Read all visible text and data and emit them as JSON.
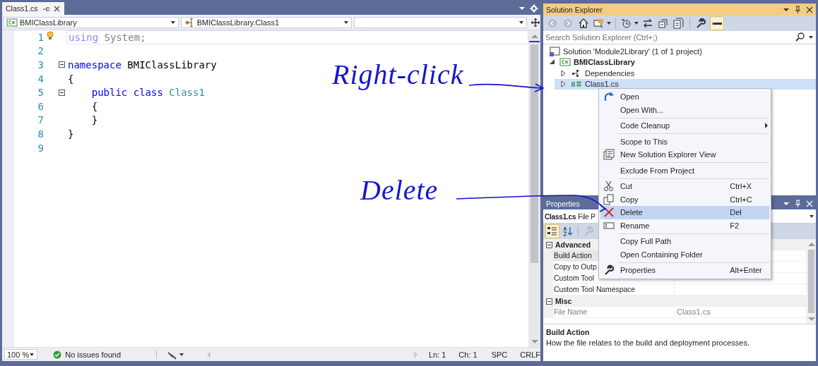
{
  "editor_tab": {
    "title": "Class1.cs",
    "selected": true
  },
  "nav_bar": {
    "project": "BMIClassLibrary",
    "type": "BMIClassLibrary.Class1"
  },
  "code": {
    "lines": [
      {
        "number": "1",
        "hint": true,
        "current": true,
        "fold": false,
        "tokens": [
          {
            "text": "using",
            "kind": "unused-keyword"
          },
          {
            "text": " System;",
            "kind": "unused"
          }
        ]
      },
      {
        "number": "2",
        "hint": false,
        "current": false,
        "fold": false
      },
      {
        "number": "3",
        "hint": false,
        "current": false,
        "fold": true,
        "tokens": [
          {
            "text": "namespace",
            "kind": "keyword"
          },
          {
            "text": " BMIClassLibrary",
            "kind": "plain"
          }
        ]
      },
      {
        "number": "4",
        "hint": false,
        "current": false,
        "fold": false,
        "tokens": [
          {
            "text": "{",
            "kind": "plain"
          }
        ]
      },
      {
        "number": "5",
        "hint": false,
        "current": false,
        "fold": true,
        "tokens": [
          {
            "text": "    public class",
            "kind": "keyword"
          },
          {
            "text": " Class1",
            "kind": "type"
          }
        ]
      },
      {
        "number": "6",
        "hint": false,
        "current": false,
        "fold": false,
        "tokens": [
          {
            "text": "    {",
            "kind": "plain"
          }
        ]
      },
      {
        "number": "7",
        "hint": false,
        "current": false,
        "fold": false,
        "tokens": [
          {
            "text": "    }",
            "kind": "plain"
          }
        ]
      },
      {
        "number": "8",
        "hint": false,
        "current": false,
        "fold": false,
        "tokens": [
          {
            "text": "}",
            "kind": "plain"
          }
        ]
      },
      {
        "number": "9",
        "hint": false,
        "current": false,
        "fold": false
      }
    ]
  },
  "status_bar": {
    "zoom": "100 %",
    "issues": "No issues found",
    "line": "Ln: 1",
    "column": "Ch: 1",
    "whitespace": "SPC",
    "line_endings": "CRLF"
  },
  "solution_explorer": {
    "title": "Solution Explorer",
    "search": {
      "placeholder": "Search Solution Explorer (Ctrl+;)"
    },
    "tree": [
      {
        "label": "Solution 'Module2Library' (1 of 1 project)",
        "kind": "solution",
        "selected": false,
        "children": [
          {
            "label": "BMIClassLibrary",
            "kind": "project",
            "selected": false,
            "expanded": true,
            "children": [
              {
                "label": "Dependencies",
                "kind": "dependencies",
                "selected": false,
                "expanded": false
              },
              {
                "label": "Class1.cs",
                "kind": "file",
                "selected": true,
                "expanded": false
              }
            ]
          }
        ]
      }
    ]
  },
  "properties": {
    "title": "Properties",
    "object": {
      "name": "Class1.cs",
      "type": "File P"
    },
    "categories": [
      {
        "name": "Advanced",
        "expanded": true,
        "rows": [
          {
            "name": "Build Action",
            "selected": true,
            "readonly": false
          },
          {
            "name": "Copy to Outp",
            "selected": false,
            "readonly": false
          },
          {
            "name": "Custom Tool",
            "selected": false,
            "readonly": false
          },
          {
            "name": "Custom Tool Namespace",
            "selected": false,
            "readonly": false
          }
        ]
      },
      {
        "name": "Misc",
        "expanded": true,
        "rows": [
          {
            "name": "File Name",
            "value": "Class1.cs",
            "selected": false,
            "readonly": true
          }
        ]
      }
    ],
    "description": {
      "title": "Build Action",
      "text": "How the file relates to the build and deployment processes."
    }
  },
  "context_menu": {
    "items": [
      {
        "kind": "item",
        "label": "Open",
        "selected": false,
        "submenu": false
      },
      {
        "kind": "item",
        "label": "Open With...",
        "selected": false,
        "submenu": false
      },
      {
        "kind": "separator"
      },
      {
        "kind": "item",
        "label": "Code Cleanup",
        "selected": false,
        "submenu": true
      },
      {
        "kind": "separator"
      },
      {
        "kind": "item",
        "label": "Scope to This",
        "selected": false,
        "submenu": false
      },
      {
        "kind": "item",
        "label": "New Solution Explorer View",
        "selected": false,
        "submenu": false
      },
      {
        "kind": "separator"
      },
      {
        "kind": "item",
        "label": "Exclude From Project",
        "selected": false,
        "submenu": false
      },
      {
        "kind": "separator"
      },
      {
        "kind": "item",
        "label": "Cut",
        "shortcut": "Ctrl+X",
        "selected": false,
        "submenu": false
      },
      {
        "kind": "item",
        "label": "Copy",
        "shortcut": "Ctrl+C",
        "selected": false,
        "submenu": false
      },
      {
        "kind": "item",
        "label": "Delete",
        "shortcut": "Del",
        "selected": true,
        "submenu": false
      },
      {
        "kind": "item",
        "label": "Rename",
        "shortcut": "F2",
        "selected": false,
        "submenu": false
      },
      {
        "kind": "separator"
      },
      {
        "kind": "item",
        "label": "Copy Full Path",
        "selected": false,
        "submenu": false
      },
      {
        "kind": "item",
        "label": "Open Containing Folder",
        "selected": false,
        "submenu": false
      },
      {
        "kind": "separator"
      },
      {
        "kind": "item",
        "label": "Properties",
        "shortcut": "Alt+Enter",
        "selected": false,
        "submenu": false
      }
    ]
  },
  "annotations": [
    {
      "text": "Right-click"
    },
    {
      "text": "Delete"
    }
  ]
}
